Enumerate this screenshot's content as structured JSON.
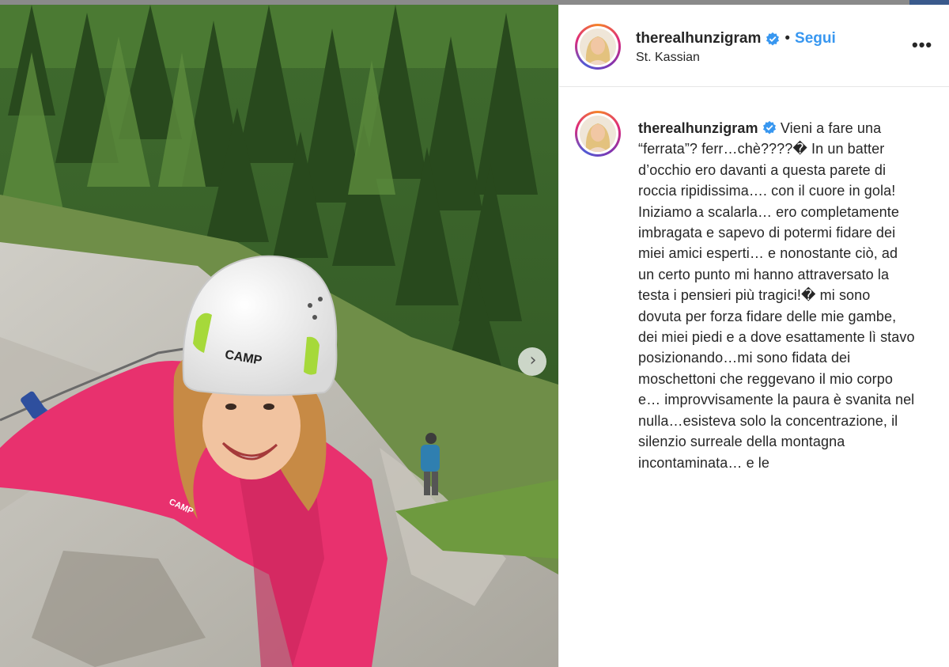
{
  "post": {
    "username": "therealhunzigram",
    "follow_label": "Segui",
    "separator": "•",
    "location": "St. Kassian",
    "more_label": "•••",
    "next_label": "›"
  },
  "photo": {
    "helmet_brand": "CAMP",
    "lanyard_brand": "CAMP"
  },
  "caption": {
    "username": "therealhunzigram",
    "text": "Vieni a fare una “ferrata”? ferr…chè????� In un batter d’occhio ero davanti a questa parete di roccia ripidissima…. con il cuore in gola! Iniziamo a scalarla… ero completamente imbragata e sapevo di potermi fidare dei miei amici esperti… e nonostante ciò, ad un certo punto mi hanno attraversato la testa i pensieri più tragici!� mi sono dovuta per forza fidare delle mie gambe, dei miei piedi e a dove esattamente lì stavo posizionando…mi sono fidata dei moschettoni che reggevano il mio corpo e… improvvisamente la paura è svanita nel nulla…esisteva solo la concentrazione, il silenzio surreale della montagna incontaminata… e le"
  },
  "colors": {
    "link_blue": "#3897f0",
    "verified_blue": "#3897f0",
    "jacket_pink": "#e8316e",
    "helmet_white": "#f4f4f4"
  }
}
